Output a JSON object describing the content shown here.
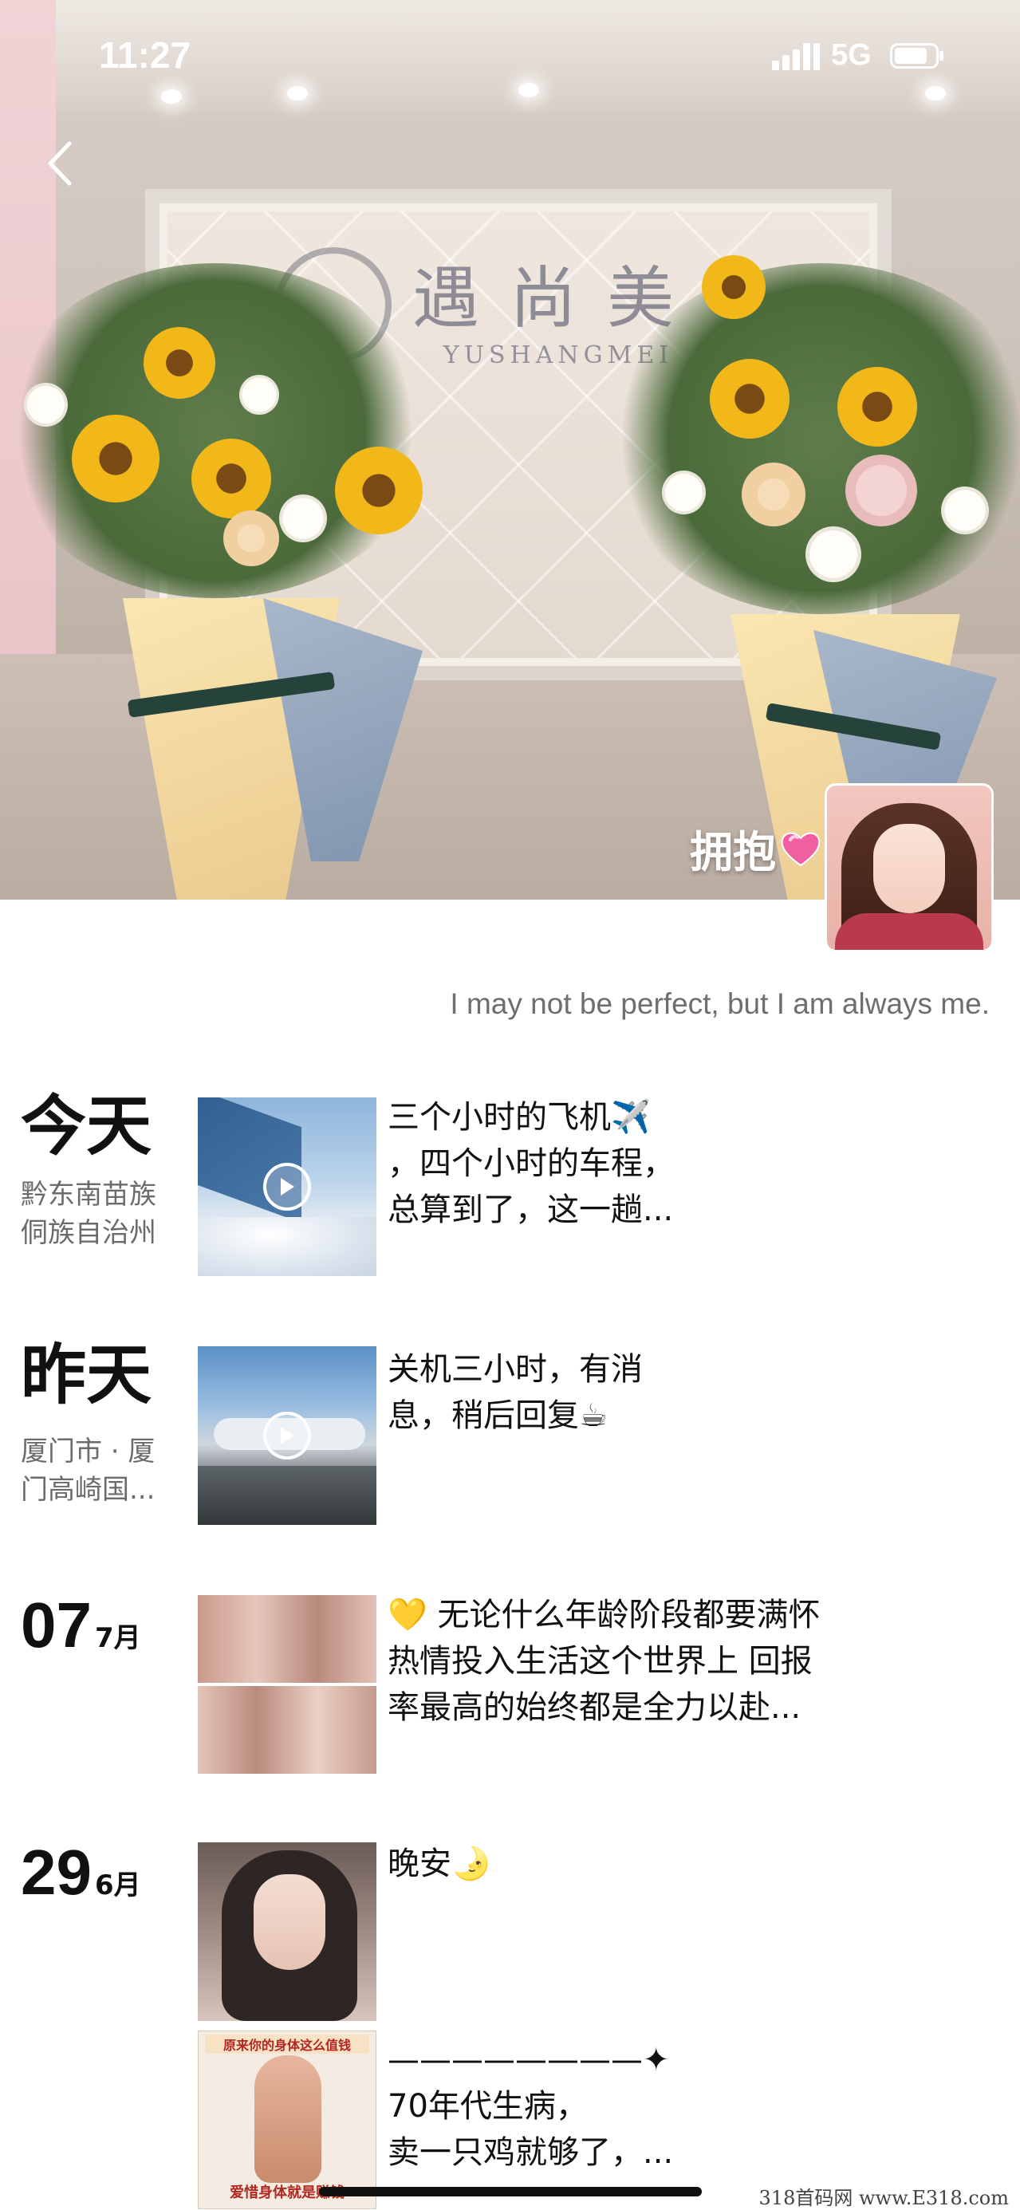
{
  "status_bar": {
    "time": "11:27",
    "network": "5G"
  },
  "cover": {
    "store_name_cn": "遇尚美",
    "store_name_en": "YUSHANGMEI"
  },
  "profile": {
    "name": "拥抱",
    "signature": "I may not be perfect, but I am always me."
  },
  "moments": [
    {
      "day": "今天",
      "location": "黔东南苗族侗族自治州",
      "media": "video",
      "text_lines": [
        "三个小时的飞机✈️",
        "，四个小时的车程，",
        "总算到了，这一趟..."
      ]
    },
    {
      "day": "昨天",
      "location": "厦门市 · 厦门高崎国...",
      "media": "video",
      "text_lines": [
        "关机三小时，有消",
        "息，稍后回复☕"
      ]
    },
    {
      "date_day": "07",
      "date_month": "7月",
      "media": "photo",
      "text_lines": [
        "💛 无论什么年龄阶段都要满怀",
        "热情投入生活这个世界上 回报",
        "率最高的始终都是全力以赴..."
      ]
    },
    {
      "date_day": "29",
      "date_month": "6月",
      "media": "photo",
      "text_lines": [
        "晚安🌛"
      ]
    },
    {
      "media": "photo",
      "thumb_title": "原来你的身体这么值钱",
      "thumb_footer": "爱惜身体就是赚钱",
      "text_lines": [
        "————————✦",
        "70年代生病，",
        "卖一只鸡就够了，..."
      ]
    }
  ],
  "watermark": "318首码网 www.E318.com",
  "icons": {
    "back": "chevron-left-icon",
    "signal": "signal-icon",
    "battery": "battery-icon",
    "heart": "heart-icon",
    "play": "play-icon"
  }
}
